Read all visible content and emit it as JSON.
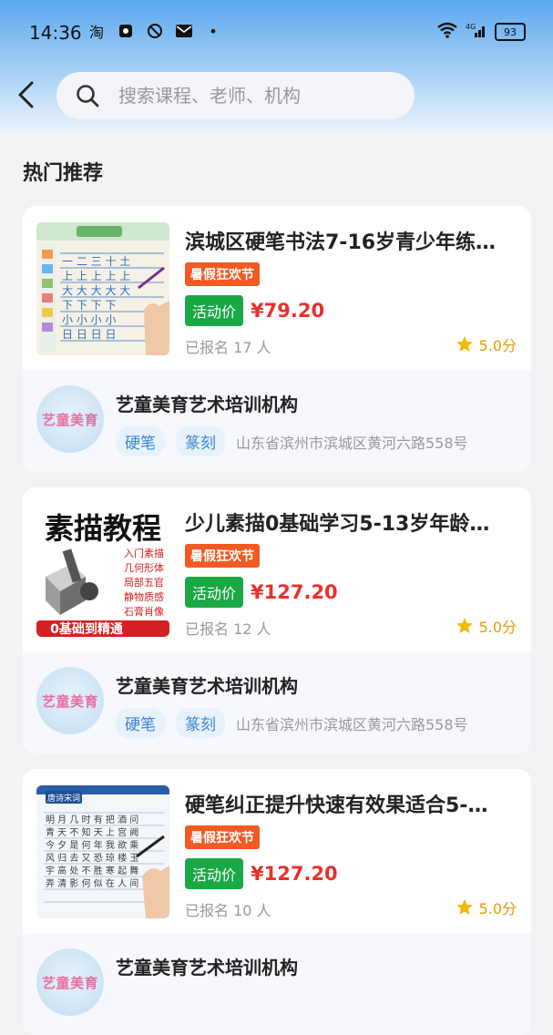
{
  "status_bar": {
    "time": "14:36",
    "battery": "93",
    "network": "4G"
  },
  "search": {
    "placeholder": "搜索课程、老师、机构"
  },
  "section": {
    "title": "热门推荐"
  },
  "courses": [
    {
      "title": "滨城区硬笔书法7-16岁青少年练…",
      "promo": "暑假狂欢节",
      "activity_label": "活动价",
      "price": "¥79.20",
      "enrolled": "已报名 17 人",
      "rating": "5.0分",
      "org": {
        "name": "艺童美育艺术培训机构",
        "avatar_text": "艺童美育",
        "tags": [
          "硬笔",
          "篆刻"
        ],
        "address": "山东省滨州市滨城区黄河六路558号"
      }
    },
    {
      "title": "少儿素描0基础学习5-13岁年龄…",
      "promo": "暑假狂欢节",
      "activity_label": "活动价",
      "price": "¥127.20",
      "enrolled": "已报名 12 人",
      "rating": "5.0分",
      "thumb": {
        "headline": "素描教程",
        "topics": [
          "入门素描",
          "几何形体",
          "局部五官",
          "静物质感",
          "石膏肖像"
        ],
        "banner": "0基础到精通"
      },
      "org": {
        "name": "艺童美育艺术培训机构",
        "avatar_text": "艺童美育",
        "tags": [
          "硬笔",
          "篆刻"
        ],
        "address": "山东省滨州市滨城区黄河六路558号"
      }
    },
    {
      "title": "硬笔纠正提升快速有效果适合5-…",
      "promo": "暑假狂欢节",
      "activity_label": "活动价",
      "price": "¥127.20",
      "enrolled": "已报名 10 人",
      "rating": "5.0分",
      "thumb": {
        "label": "唐诗宋词"
      },
      "org": {
        "name": "艺童美育艺术培训机构",
        "avatar_text": "艺童美育",
        "tags": [],
        "address": ""
      }
    }
  ],
  "colors": {
    "promo": "#f15a22",
    "activity": "#1aa845",
    "price": "#e8302c",
    "rating": "#e69a00",
    "tag_text": "#3b86d1"
  }
}
